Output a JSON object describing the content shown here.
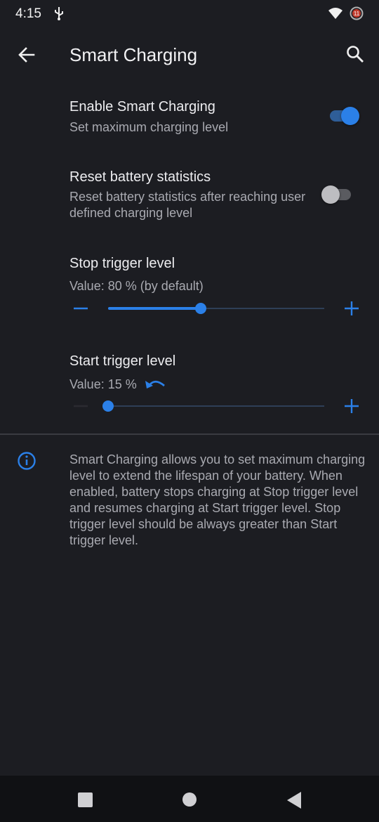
{
  "status_bar": {
    "time": "4:15",
    "battery_badge": "11"
  },
  "app_bar": {
    "title": "Smart Charging"
  },
  "settings": {
    "enable": {
      "title": "Enable Smart Charging",
      "subtitle": "Set maximum charging level",
      "on": true
    },
    "reset": {
      "title": "Reset battery statistics",
      "subtitle": "Reset battery statistics after reaching user defined charging level",
      "on": false
    },
    "stop_trigger": {
      "title": "Stop trigger level",
      "value_text": "Value: 80 % (by default)",
      "fraction": 0.43
    },
    "start_trigger": {
      "title": "Start trigger level",
      "value_text": "Value: 15 %",
      "fraction": 0.0
    }
  },
  "info": {
    "text": "Smart Charging allows you to set maximum charging level to extend the lifespan of your battery. When enabled, battery stops charging at Stop trigger level and resumes charging at Start trigger level. Stop trigger level should be always greater than Start trigger level."
  },
  "colors": {
    "accent": "#2b80e8",
    "background": "#1c1d22"
  },
  "icons": [
    "usb-icon",
    "wifi-icon",
    "battery-icon",
    "back-arrow-icon",
    "search-icon",
    "minus-icon",
    "plus-icon",
    "undo-icon",
    "info-icon"
  ]
}
